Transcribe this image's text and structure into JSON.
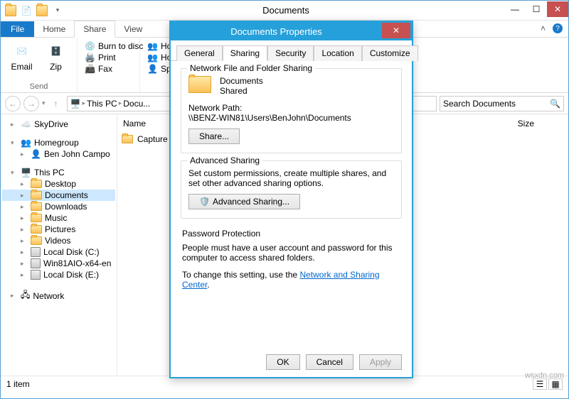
{
  "titlebar": {
    "title": "Documents"
  },
  "ribbon": {
    "file": "File",
    "tabs": [
      "Home",
      "Share",
      "View"
    ],
    "email": "Email",
    "zip": "Zip",
    "burn": "Burn to disc",
    "print": "Print",
    "fax": "Fax",
    "sendLabel": "Send",
    "dest0": "Hom",
    "dest1": "Hom",
    "dest2": "Spec"
  },
  "nav": {
    "crumbs": [
      "This PC",
      "Docu..."
    ],
    "searchPlaceholder": "Search Documents"
  },
  "columns": {
    "name": "Name",
    "size": "Size"
  },
  "file0": "Capture",
  "tree": {
    "skydrive": "SkyDrive",
    "homegroup": "Homegroup",
    "user": "Ben John Campo",
    "thispc": "This PC",
    "desktop": "Desktop",
    "documents": "Documents",
    "downloads": "Downloads",
    "music": "Music",
    "pictures": "Pictures",
    "videos": "Videos",
    "diskC": "Local Disk (C:)",
    "diskD": "Win81AIO-x64-en",
    "diskE": "Local Disk (E:)",
    "network": "Network"
  },
  "status": {
    "items": "1 item"
  },
  "dialog": {
    "title": "Documents Properties",
    "tabs": [
      "General",
      "Sharing",
      "Security",
      "Location",
      "Customize"
    ],
    "g1": {
      "legend": "Network File and Folder Sharing",
      "name": "Documents",
      "state": "Shared",
      "pathLabel": "Network Path:",
      "path": "\\\\BENZ-WIN81\\Users\\BenJohn\\Documents",
      "shareBtn": "Share..."
    },
    "g2": {
      "legend": "Advanced Sharing",
      "desc": "Set custom permissions, create multiple shares, and set other advanced sharing options.",
      "btn": "Advanced Sharing..."
    },
    "g3": {
      "legend": "Password Protection",
      "line1": "People must have a user account and password for this computer to access shared folders.",
      "line2a": "To change this setting, use the ",
      "link": "Network and Sharing Center",
      "line2b": "."
    },
    "ok": "OK",
    "cancel": "Cancel",
    "apply": "Apply"
  },
  "watermark": "wsxdn.com"
}
